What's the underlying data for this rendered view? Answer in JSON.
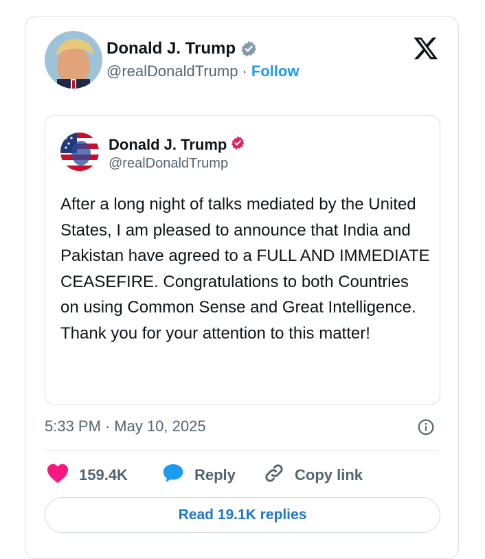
{
  "author": {
    "name": "Donald J. Trump",
    "handle": "@realDonaldTrump",
    "separator": "·",
    "follow_label": "Follow"
  },
  "quote": {
    "name": "Donald J. Trump",
    "handle": "@realDonaldTrump",
    "text": "After a long night of talks mediated by the United States, I am pleased to announce that India and Pakistan have agreed to a FULL AND IMMEDIATE CEASEFIRE. Congratulations to both Countries on using Common Sense and Great Intelligence. Thank you for your attention to this matter!"
  },
  "timestamp": {
    "time": "5:33 PM",
    "separator": "·",
    "date": "May 10, 2025"
  },
  "actions": {
    "likes": "159.4K",
    "reply_label": "Reply",
    "copy_label": "Copy link"
  },
  "read_replies_label": "Read 19.1K replies",
  "icons": {
    "verified": "verified-badge-icon",
    "verified_pink": "verified-badge-icon",
    "brand": "x-logo-icon",
    "info": "info-icon",
    "like": "heart-icon",
    "reply": "speech-bubble-icon",
    "copy": "link-icon"
  },
  "colors": {
    "accent": "#1d9bf0",
    "like": "#f91880",
    "verified_gray": "#829aab",
    "verified_pink": "#e0245e",
    "read_button_text": "#1d75d1"
  }
}
